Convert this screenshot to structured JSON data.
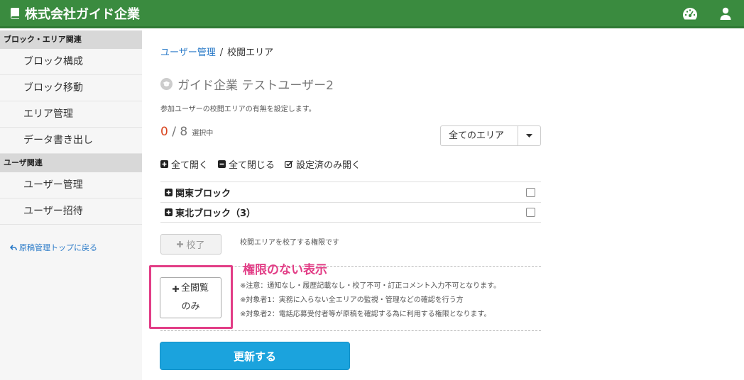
{
  "header": {
    "brand": "株式会社ガイド企業",
    "brand_icon": "book-icon",
    "right_icons": [
      "dashboard-icon",
      "user-icon"
    ],
    "color": "#3a8b3f"
  },
  "sidebar": {
    "section1": "ブロック・エリア関連",
    "items1": [
      "ブロック構成",
      "ブロック移動",
      "エリア管理",
      "データ書き出し"
    ],
    "section2": "ユーザ関連",
    "items2": [
      "ユーザー管理",
      "ユーザー招待"
    ],
    "back_link": "原稿管理トップに戻る"
  },
  "main": {
    "breadcrumb": {
      "parent": "ユーザー管理",
      "separator": "/",
      "current": "校閲エリア"
    },
    "title": "ガイド企業 テストユーザー2",
    "description": "参加ユーザーの校閲エリアの有無を設定します。",
    "count": {
      "selected": "0",
      "sep": " / ",
      "total": "8",
      "suffix": "選択中"
    },
    "area_filter": {
      "selected": "全てのエリア"
    },
    "toolbar": {
      "expand_all": "全て開く",
      "collapse_all": "全て閉じる",
      "open_configured": "設定済のみ開く"
    },
    "blocks": [
      {
        "label": "関東ブロック",
        "checked": false
      },
      {
        "label": "東北ブロック（3）",
        "checked": false
      }
    ],
    "proof_button": "校了",
    "proof_note": "校閲エリアを校了する権限です",
    "annotation": "権限のない表示",
    "full_view_button": {
      "line1": "全閲覧",
      "line2": "のみ"
    },
    "notes": [
      "※注意：通知なし・履歴記載なし・校了不可・訂正コメント入力不可となります。",
      "※対象者1：実務に入らない全エリアの監視・管理などの確認を行う方",
      "※対象者2：電話応募受付者等が原稿を確認する為に利用する権限となります。"
    ],
    "update_button": "更新する",
    "accent": "#1ba3dd",
    "annotation_color": "#e23d86"
  }
}
